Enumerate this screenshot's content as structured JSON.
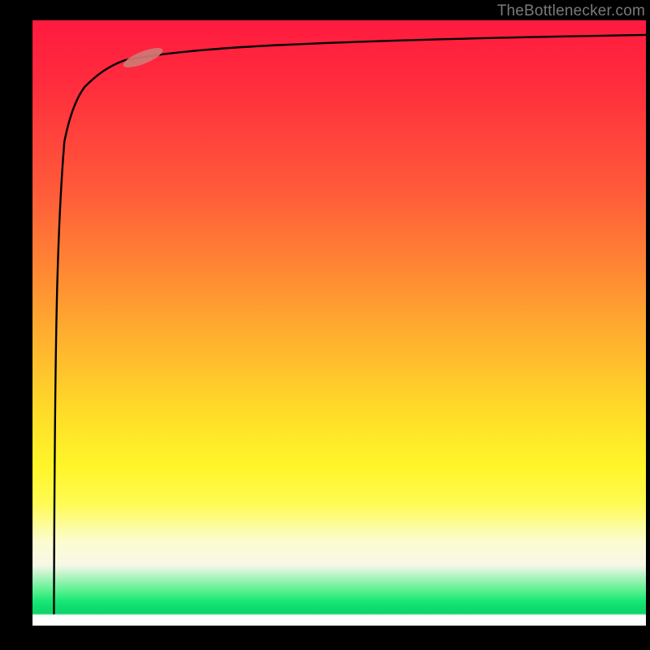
{
  "watermark": "TheBottlenecker.com",
  "colors": {
    "gradient_top": "#ff1a3f",
    "gradient_mid1": "#ff8a33",
    "gradient_mid2": "#ffe028",
    "gradient_pale": "#fcfccf",
    "gradient_green": "#18e676",
    "curve": "#000000",
    "marker": "#cf7a74",
    "background": "#000000"
  },
  "chart_data": {
    "type": "line",
    "title": "",
    "xlabel": "",
    "ylabel": "",
    "xlim": [
      0,
      100
    ],
    "ylim": [
      0,
      100
    ],
    "grid": false,
    "legend": false,
    "series": [
      {
        "name": "curve",
        "x": [
          3.5,
          3.6,
          3.8,
          4.0,
          4.3,
          4.7,
          5.2,
          6.0,
          7.0,
          8.5,
          10,
          12,
          15,
          20,
          28,
          40,
          55,
          70,
          85,
          100
        ],
        "y": [
          2,
          20,
          40,
          55,
          66,
          74,
          80,
          84,
          87,
          89.5,
          91,
          92.3,
          93.4,
          94.4,
          95.3,
          96.1,
          96.6,
          97.0,
          97.3,
          97.5
        ]
      }
    ],
    "marker": {
      "x": 18,
      "y": 94.0,
      "angle_deg": 22
    }
  }
}
